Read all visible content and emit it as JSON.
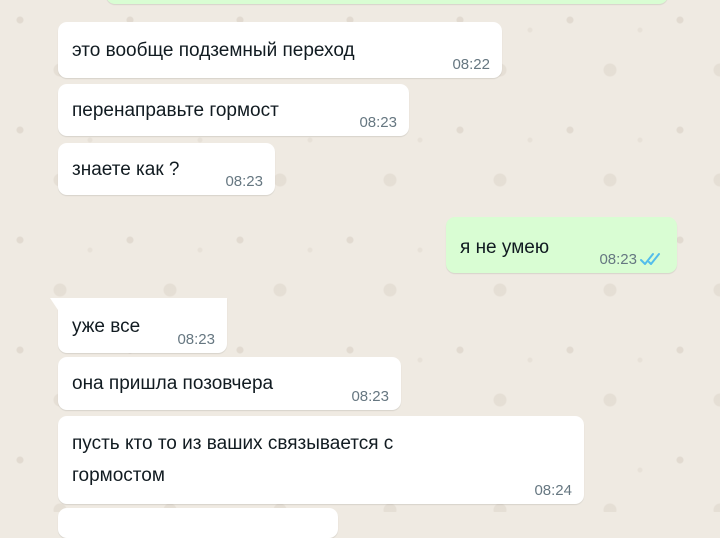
{
  "messages": [
    {
      "dir": "out",
      "text": "",
      "time": ""
    },
    {
      "dir": "in",
      "text": "это вообще подземный переход",
      "time": "08:22"
    },
    {
      "dir": "in",
      "text": "перенаправьте гормост",
      "time": "08:23"
    },
    {
      "dir": "in",
      "text": "знаете как ?",
      "time": "08:23"
    },
    {
      "dir": "out",
      "text": "я не умею",
      "time": "08:23",
      "status": "read"
    },
    {
      "dir": "in",
      "text": "уже все",
      "time": "08:23"
    },
    {
      "dir": "in",
      "text": "она пришла позовчера",
      "time": "08:23"
    },
    {
      "dir": "in",
      "text_lines": [
        "пусть кто то из ваших связывается с",
        "гормостом"
      ],
      "time": "08:24"
    },
    {
      "dir": "in",
      "text": "",
      "time": ""
    }
  ],
  "colors": {
    "wallpaper": "#efeae2",
    "incoming_bubble": "#ffffff",
    "outgoing_bubble": "#d9fdd3",
    "text": "#111b21",
    "timestamp": "#667781",
    "read_ticks": "#53bdeb"
  },
  "icons": {
    "read_receipt": "double-check-icon"
  }
}
